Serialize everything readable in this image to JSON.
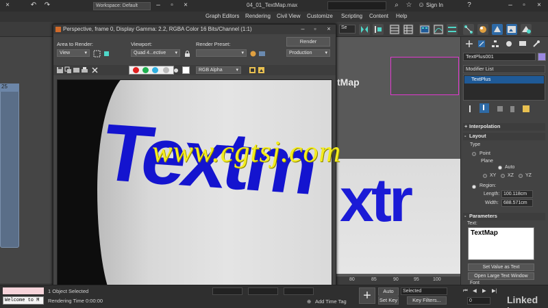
{
  "window": {
    "title": "04_01_TextMap.max",
    "workspace_label": "Workspace: Default",
    "sign_in": "Sign In"
  },
  "menu": [
    "Graph Editors",
    "Rendering",
    "Civil View",
    "Customize",
    "Scripting",
    "Content",
    "Help"
  ],
  "toolbar": {
    "selection_set": "Se"
  },
  "left_panel": {
    "node_label": "25"
  },
  "render_window": {
    "title": "Perspective, frame 0, Display Gamma: 2.2, RGBA Color 16 Bits/Channel (1:1)",
    "area_to_render_label": "Area to Render:",
    "area_to_render_value": "View",
    "viewport_label": "Viewport:",
    "viewport_value": "Quad 4...ective",
    "render_preset_label": "Render Preset:",
    "render_preset_value": "",
    "render_button": "Render",
    "production_value": "Production",
    "channel_value": "RGB Alpha",
    "rendered_text": "Textm"
  },
  "viewport": {
    "label": "tMap",
    "big_text": "xtr",
    "timeline_ticks": [
      "80",
      "85",
      "90",
      "95",
      "100"
    ]
  },
  "watermark": "www.cgtsj.com",
  "command_panel": {
    "object_name": "TextPlus001",
    "object_color": "#9b88e0",
    "modifier_list": "Modifier List",
    "modifier_item": "TextPlus",
    "rollouts": {
      "interpolation": "Interpolation",
      "layout": "Layout",
      "parameters": "Parameters"
    },
    "layout": {
      "type_label": "Type",
      "point_label": "Point",
      "plane_label": "Plane",
      "auto_label": "Auto",
      "xy": "XY",
      "xz": "XZ",
      "yz": "YZ",
      "region_label": "Region:",
      "length_label": "Length:",
      "length_value": "100.118cm",
      "width_label": "Width:",
      "width_value": "688.571cm"
    },
    "parameters": {
      "text_label": "Text:",
      "text_value": "TextMap",
      "set_value_button": "Set Value as Text",
      "large_text_button": "Open Large Text Window",
      "font_label": "Font"
    }
  },
  "status": {
    "maxscript": "Welcome to M",
    "selected_count": "1 Object Selected",
    "rendering_time": "Rendering Time  0:00:00",
    "add_time_tag": "Add Time Tag",
    "auto_key": "Auto Key",
    "set_key": "Set Key",
    "selected_dropdown": "Selected",
    "key_filters": "Key Filters...",
    "frame_value": "0"
  },
  "branding": "Linked in"
}
